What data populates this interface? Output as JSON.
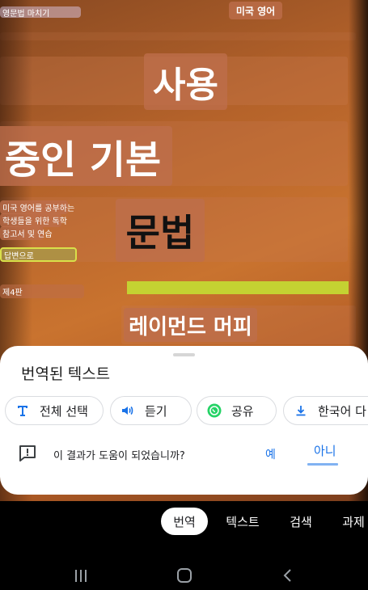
{
  "camera_overlay": {
    "top_left_text": "영문법 마치기",
    "top_right_text": "미국 영어",
    "line1": "사용",
    "line2": "중인 기본",
    "line3": "문법",
    "line4": "레이먼드 머피",
    "side_texts": [
      "미국 영어를 공부하는",
      "학생들을 위한 독학",
      "참고서 및 연습",
      "답변으로",
      "제4판"
    ]
  },
  "sheet": {
    "title": "번역된 텍스트",
    "chips": [
      {
        "label": "전체 선택",
        "icon": "text-format-icon"
      },
      {
        "label": "듣기",
        "icon": "speaker-icon"
      },
      {
        "label": "공유",
        "icon": "whatsapp-icon"
      },
      {
        "label": "한국어 다",
        "icon": "download-icon"
      }
    ],
    "feedback": {
      "question": "이 결과가 도움이 되었습니까?",
      "yes_label": "예",
      "no_label": "아니"
    }
  },
  "mode_tabs": [
    {
      "label": "번역",
      "active": true
    },
    {
      "label": "텍스트",
      "active": false
    },
    {
      "label": "검색",
      "active": false
    },
    {
      "label": "과제",
      "active": false
    }
  ],
  "colors": {
    "accent": "#1a73e8",
    "highlight_yellow": "#c4d232",
    "whatsapp_green": "#25d366"
  }
}
